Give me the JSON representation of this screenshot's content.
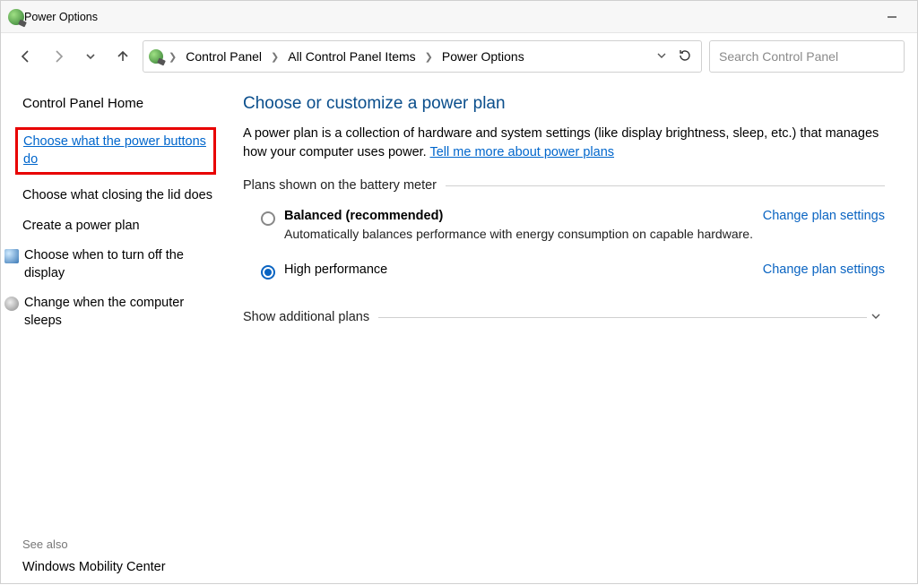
{
  "window": {
    "title": "Power Options"
  },
  "breadcrumbs": {
    "items": [
      "Control Panel",
      "All Control Panel Items",
      "Power Options"
    ]
  },
  "search": {
    "placeholder": "Search Control Panel"
  },
  "sidebar": {
    "home": "Control Panel Home",
    "links": [
      {
        "label": "Choose what the power buttons do",
        "highlighted": true
      },
      {
        "label": "Choose what closing the lid does"
      },
      {
        "label": "Create a power plan"
      },
      {
        "label": "Choose when to turn off the display",
        "icon": "monitor"
      },
      {
        "label": "Change when the computer sleeps",
        "icon": "sleep"
      }
    ],
    "seealso_label": "See also",
    "seealso_link": "Windows Mobility Center"
  },
  "main": {
    "heading": "Choose or customize a power plan",
    "description_lead": "A power plan is a collection of hardware and system settings (like display brightness, sleep, etc.) that manages how your computer uses power. ",
    "description_link": "Tell me more about power plans",
    "plans_legend": "Plans shown on the battery meter",
    "plans": [
      {
        "name": "Balanced (recommended)",
        "description": "Automatically balances performance with energy consumption on capable hardware.",
        "selected": false,
        "change_label": "Change plan settings"
      },
      {
        "name": "High performance",
        "description": "",
        "selected": true,
        "change_label": "Change plan settings"
      }
    ],
    "additional_legend": "Show additional plans"
  }
}
